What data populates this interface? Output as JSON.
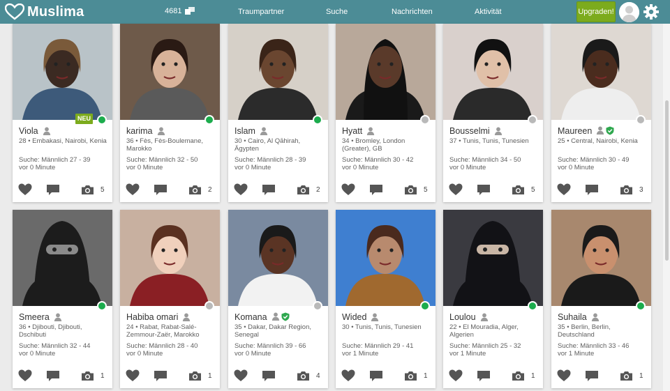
{
  "header": {
    "brand": "Muslima",
    "online_count": "4681",
    "nav": [
      "Traumpartner",
      "Suche",
      "Nachrichten",
      "Aktivität"
    ],
    "upgrade_label": "Upgraden!",
    "icons": {
      "logo": "heart-logo-icon",
      "count": "online-users-icon",
      "avatar": "user-avatar-icon",
      "settings": "gear-icon"
    }
  },
  "colors": {
    "header": "#4c8c96",
    "accent": "#7cab1d",
    "online": "#1cac4d",
    "offline": "#b9b9b9",
    "action_icon": "#555555"
  },
  "profiles": [
    {
      "name": "Viola",
      "location": "28 • Embakasi, Nairobi, Kenia",
      "search": "Suche: Männlich 27 - 39",
      "last_seen": "vor 0 Minute",
      "photos": "5",
      "online": true,
      "verified": false,
      "new_label": "NEU"
    },
    {
      "name": "karima",
      "location": "36 • Fès, Fès-Boulemane, Marokko",
      "search": "Suche: Männlich 32 - 50",
      "last_seen": "vor 0 Minute",
      "photos": "2",
      "online": true,
      "verified": false
    },
    {
      "name": "Islam",
      "location": "30 • Cairo, Al Qāhirah, Ägypten",
      "search": "Suche: Männlich 28 - 39",
      "last_seen": "vor 0 Minute",
      "photos": "2",
      "online": true,
      "verified": false
    },
    {
      "name": "Hyatt",
      "location": "34 • Bromley, London (Greater), GB",
      "search": "Suche: Männlich 30 - 42",
      "last_seen": "vor 0 Minute",
      "photos": "5",
      "online": false,
      "verified": false
    },
    {
      "name": "Bousselmi",
      "location": "37 • Tunis, Tunis, Tunesien",
      "search": "Suche: Männlich 34 - 50",
      "last_seen": "vor 0 Minute",
      "photos": "5",
      "online": false,
      "verified": false
    },
    {
      "name": "Maureen",
      "location": "25 • Central, Nairobi, Kenia",
      "search": "Suche: Männlich 30 - 49",
      "last_seen": "vor 0 Minute",
      "photos": "3",
      "online": false,
      "verified": true
    },
    {
      "name": "Smeera",
      "location": "36 • Djibouti, Djibouti, Dschibuti",
      "search": "Suche: Männlich 32 - 44",
      "last_seen": "vor 0 Minute",
      "photos": "1",
      "online": true,
      "verified": false
    },
    {
      "name": "Habiba omari",
      "location": "24 • Rabat, Rabat-Salé-Zemmour-Zaër, Marokko",
      "search": "Suche: Männlich 28 - 40",
      "last_seen": "vor 0 Minute",
      "photos": "1",
      "online": false,
      "verified": false
    },
    {
      "name": "Komana",
      "location": "35 • Dakar, Dakar Region, Senegal",
      "search": "Suche: Männlich 39 - 66",
      "last_seen": "vor 0 Minute",
      "photos": "4",
      "online": false,
      "verified": true
    },
    {
      "name": "Wided",
      "location": "30 • Tunis, Tunis, Tunesien",
      "search": "Suche: Männlich 29 - 41",
      "last_seen": "vor 1 Minute",
      "photos": "1",
      "online": true,
      "verified": false
    },
    {
      "name": "Loulou",
      "location": "22 • El Mouradia, Alger, Algerien",
      "search": "Suche: Männlich 25 - 32",
      "last_seen": "vor 1 Minute",
      "photos": "1",
      "online": true,
      "verified": false
    },
    {
      "name": "Suhaila",
      "location": "35 • Berlin, Berlin, Deutschland",
      "search": "Suche: Männlich 33 - 46",
      "last_seen": "vor 1 Minute",
      "photos": "1",
      "online": true,
      "verified": false
    }
  ]
}
